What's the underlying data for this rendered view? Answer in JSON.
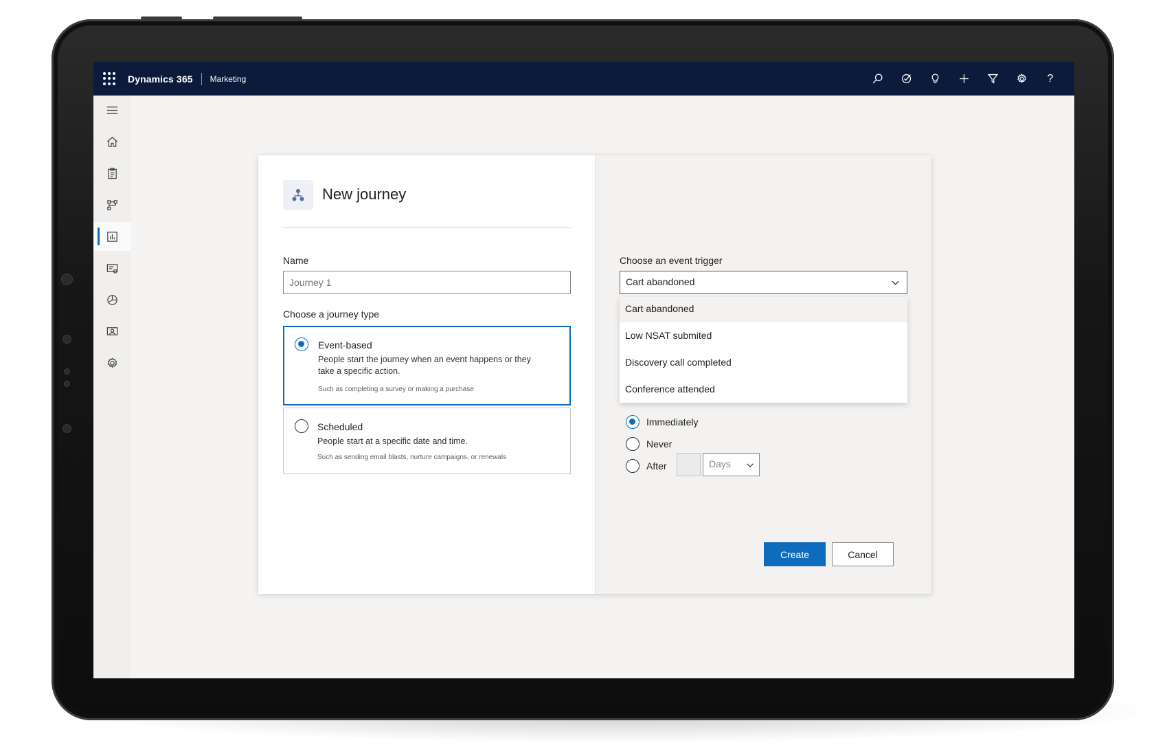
{
  "app": {
    "brand": "Dynamics 365",
    "module": "Marketing"
  },
  "topbar": {
    "icons": [
      "search-icon",
      "task-icon",
      "lightbulb-icon",
      "add-icon",
      "filter-icon",
      "settings-icon",
      "help-icon"
    ],
    "help_glyph": "?"
  },
  "rail": {
    "items": [
      "menu-icon",
      "home-icon",
      "clipboard-icon",
      "flow-icon",
      "dashboard-icon",
      "content-icon",
      "segments-icon",
      "contacts-icon",
      "settings-icon"
    ],
    "active_index": 4
  },
  "dialog": {
    "title": "New journey",
    "name_label": "Name",
    "name_placeholder": "Journey 1",
    "type_label": "Choose a journey type",
    "types": [
      {
        "title": "Event-based",
        "desc": "People start the journey when an event happens or they take a specific action.",
        "note": "Such as completing a survey or making a purchase",
        "selected": true
      },
      {
        "title": "Scheduled",
        "desc": "People start at a specific date and time.",
        "note": "Such as sending email blasts, nurture campaigns, or renewals",
        "selected": false
      }
    ],
    "trigger_label": "Choose an event trigger",
    "trigger_value": "Cart abandoned",
    "trigger_options": [
      "Cart abandoned",
      "Low NSAT submited",
      "Discovery call completed",
      "Conference attended"
    ],
    "timing_options": [
      "Immediately",
      "Never",
      "After"
    ],
    "timing_selected": "Immediately",
    "after_unit": "Days",
    "create_label": "Create",
    "cancel_label": "Cancel"
  },
  "colors": {
    "accent": "#0f6cbd",
    "topbar": "#0c1b3c"
  }
}
